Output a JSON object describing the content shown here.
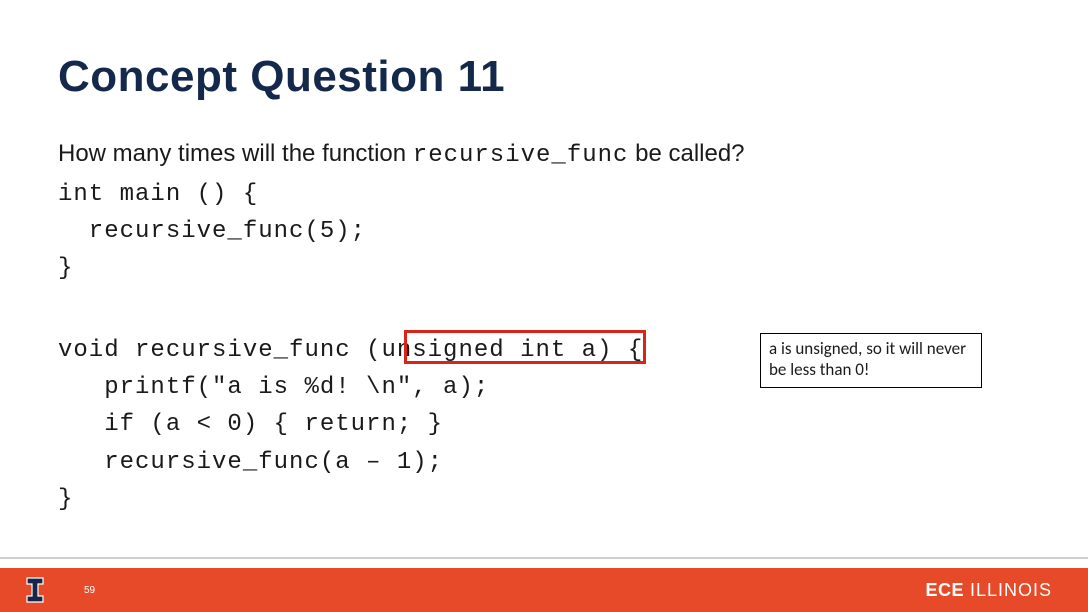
{
  "title": "Concept Question 11",
  "question": {
    "prefix": "How many times will the function ",
    "code": "recursive_func",
    "suffix": " be called?"
  },
  "code1": "int main () {\n  recursive_func(5);\n}",
  "code2": "void recursive_func (unsigned int a) {\n   printf(\"a is %d! \\n\", a);\n   if (a < 0) { return; }\n   recursive_func(a – 1);\n}",
  "annotation": "a is unsigned, so it will never be less than 0!",
  "footer": {
    "page_number": "59",
    "brand_left": "I",
    "brand_right_bold": "ECE",
    "brand_right_light": "ILLINOIS"
  },
  "colors": {
    "title_navy": "#13284b",
    "footer_orange": "#e74a28",
    "highlight_red": "#d82518"
  }
}
